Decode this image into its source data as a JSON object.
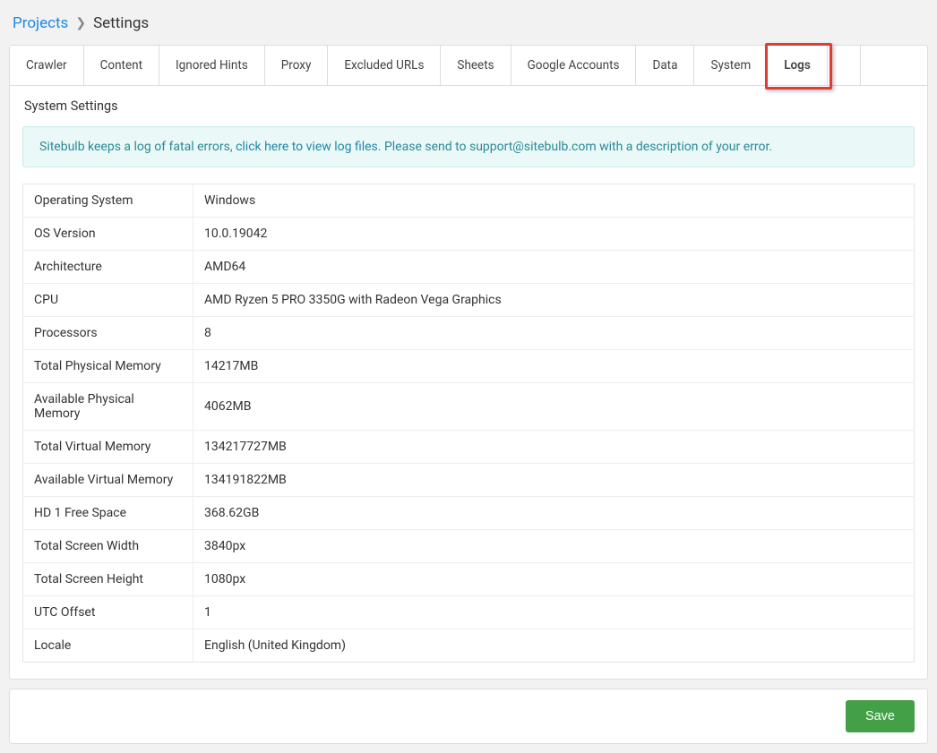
{
  "breadcrumb": {
    "root": "Projects",
    "current": "Settings"
  },
  "tabs": [
    {
      "id": "crawler",
      "label": "Crawler"
    },
    {
      "id": "content",
      "label": "Content"
    },
    {
      "id": "ignored-hints",
      "label": "Ignored Hints"
    },
    {
      "id": "proxy",
      "label": "Proxy"
    },
    {
      "id": "excluded-urls",
      "label": "Excluded URLs"
    },
    {
      "id": "sheets",
      "label": "Sheets"
    },
    {
      "id": "google-accounts",
      "label": "Google Accounts"
    },
    {
      "id": "data",
      "label": "Data"
    },
    {
      "id": "system",
      "label": "System"
    },
    {
      "id": "logs",
      "label": "Logs",
      "active": true,
      "highlighted": true
    }
  ],
  "panel": {
    "title": "System Settings",
    "info_prefix": "Sitebulb keeps a log of fatal errors, ",
    "info_link": "click here to view log files",
    "info_suffix": ". Please send to support@sitebulb.com with a description of your error."
  },
  "properties": [
    {
      "label": "Operating System",
      "value": "Windows"
    },
    {
      "label": "OS Version",
      "value": "10.0.19042"
    },
    {
      "label": "Architecture",
      "value": "AMD64"
    },
    {
      "label": "CPU",
      "value": "AMD Ryzen 5 PRO 3350G with Radeon Vega Graphics"
    },
    {
      "label": "Processors",
      "value": "8"
    },
    {
      "label": "Total Physical Memory",
      "value": "14217MB"
    },
    {
      "label": "Available Physical Memory",
      "value": "4062MB"
    },
    {
      "label": "Total Virtual Memory",
      "value": "134217727MB"
    },
    {
      "label": "Available Virtual Memory",
      "value": "134191822MB"
    },
    {
      "label": "HD 1 Free Space",
      "value": "368.62GB"
    },
    {
      "label": "Total Screen Width",
      "value": "3840px"
    },
    {
      "label": "Total Screen Height",
      "value": "1080px"
    },
    {
      "label": "UTC Offset",
      "value": "1"
    },
    {
      "label": "Locale",
      "value": "English (United Kingdom)"
    }
  ],
  "footer": {
    "save_label": "Save"
  }
}
